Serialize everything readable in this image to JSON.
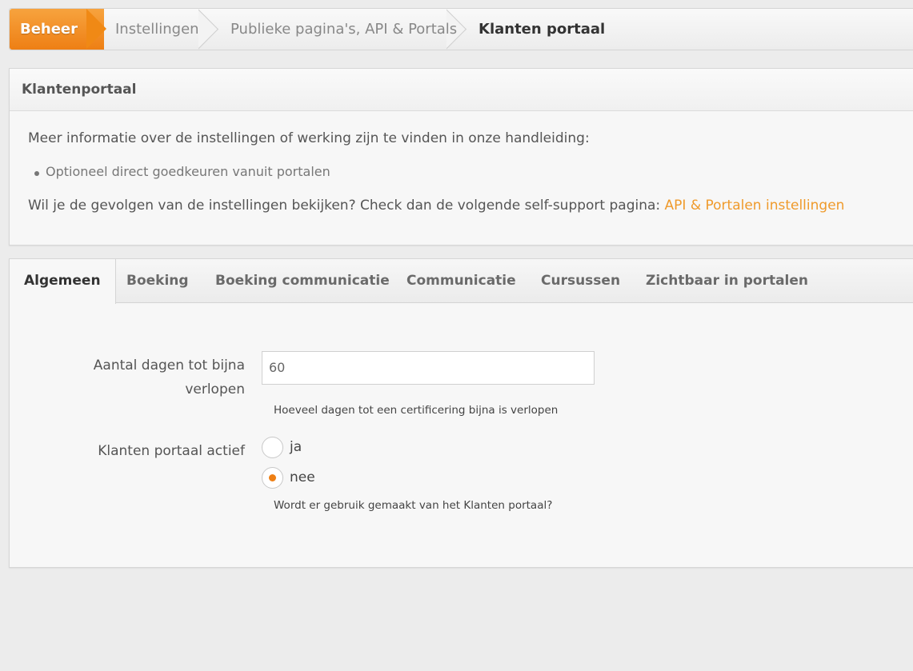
{
  "breadcrumb": {
    "home": "Beheer",
    "items": [
      "Instellingen",
      "Publieke pagina's, API & Portals",
      "Klanten portaal"
    ]
  },
  "info_panel": {
    "title": "Klantenportaal",
    "intro": "Meer informatie over de instellingen of werking zijn te vinden in onze handleiding:",
    "bullet": "Optioneel direct goedkeuren vanuit portalen",
    "support_text": "Wil je de gevolgen van de instellingen bekijken? Check dan de volgende self-support pagina:",
    "support_link": "API & Portalen instellingen"
  },
  "tabs": [
    "Algemeen",
    "Boeking",
    "Boeking communicatie",
    "Communicatie",
    "Cursussen",
    "Zichtbaar in portalen"
  ],
  "form": {
    "days_label_line1": "Aantal dagen tot bijna",
    "days_label_line2": "verlopen",
    "days_value": "60",
    "days_help": "Hoeveel dagen tot een certificering bijna is verlopen",
    "active_label": "Klanten portaal actief",
    "option_yes": "ja",
    "option_no": "nee",
    "selected_option": "nee",
    "active_help": "Wordt er gebruik gemaakt van het Klanten portaal?"
  },
  "colors": {
    "accent": "#ee7f14",
    "link": "#ef9a2b"
  }
}
